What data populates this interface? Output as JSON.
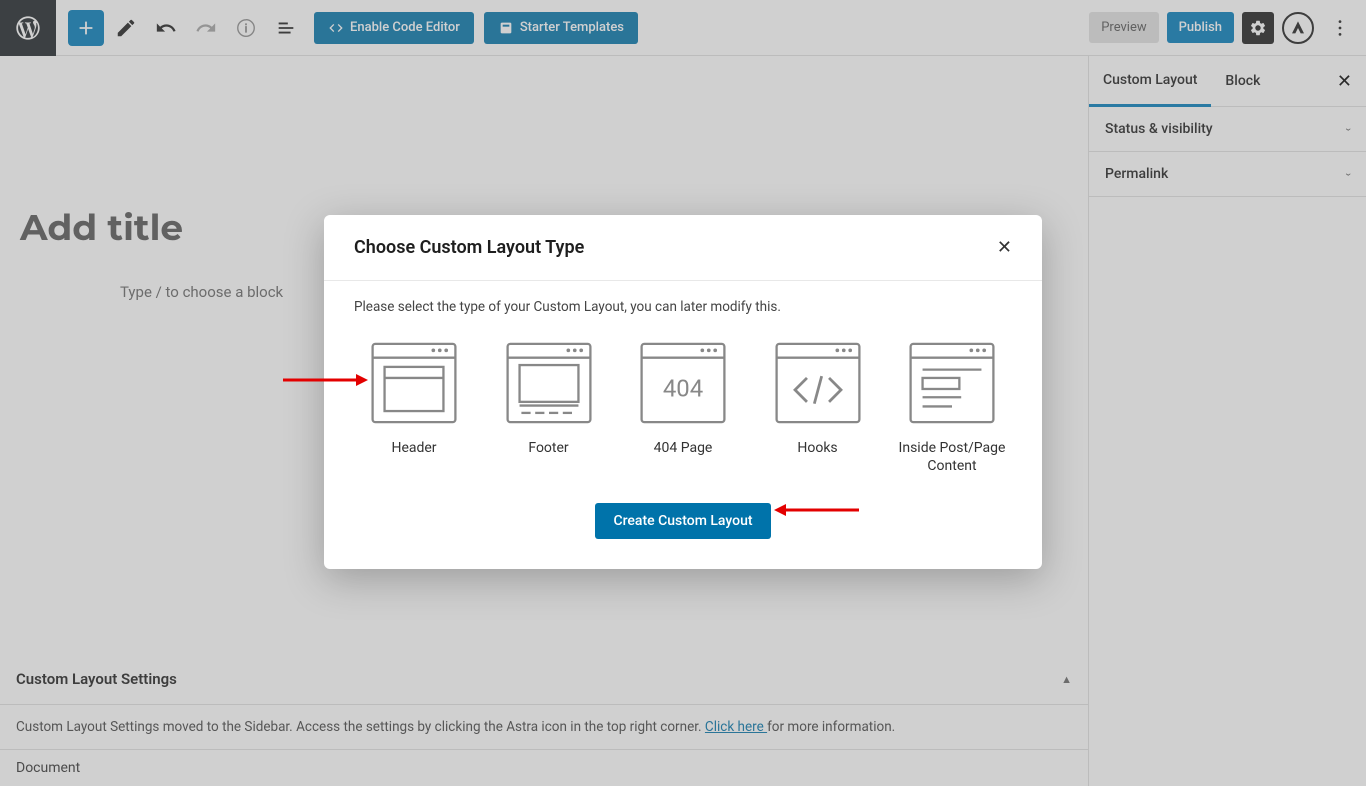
{
  "topbar": {
    "enable_code_editor": "Enable Code Editor",
    "starter_templates": "Starter Templates",
    "preview": "Preview",
    "publish": "Publish"
  },
  "editor": {
    "title_placeholder": "Add title",
    "block_prompt": "Type / to choose a block"
  },
  "sidebar": {
    "tabs": [
      "Custom Layout",
      "Block"
    ],
    "sections": [
      "Status & visibility",
      "Permalink"
    ]
  },
  "bottom_panel": {
    "title": "Custom Layout Settings",
    "message_before": "Custom Layout Settings moved to the Sidebar. Access the settings by clicking the Astra icon in the top right corner. ",
    "link_text": "Click here ",
    "message_after": "for more information.",
    "doc_tab": "Document"
  },
  "modal": {
    "title": "Choose Custom Layout Type",
    "description": "Please select the type of your Custom Layout, you can later modify this.",
    "options": [
      {
        "label": "Header"
      },
      {
        "label": "Footer"
      },
      {
        "label": "404 Page"
      },
      {
        "label": "Hooks"
      },
      {
        "label": "Inside Post/Page Content"
      }
    ],
    "create_button": "Create Custom Layout"
  }
}
